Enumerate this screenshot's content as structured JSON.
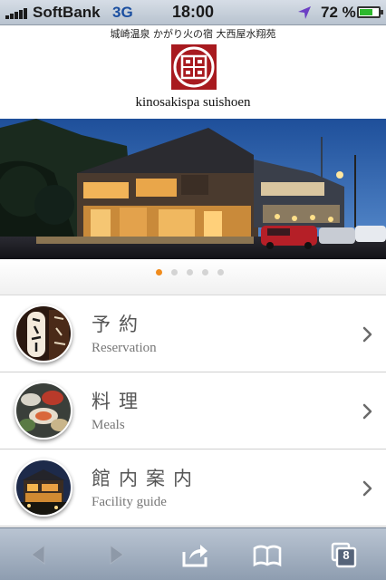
{
  "status_bar": {
    "carrier": "SoftBank",
    "network": "3G",
    "time": "18:00",
    "battery_percent": "72 %",
    "battery_level": 0.72,
    "icons": [
      "signal-bars-icon",
      "location-arrow-icon",
      "battery-icon"
    ]
  },
  "header": {
    "tagline": "城崎温泉 かがり火の宿 大西屋水翔苑",
    "brand": "kinosakispa suishoen",
    "logo_color": "#a81a1f"
  },
  "hero": {
    "image": "ryokan exterior at dusk",
    "slide_count": 5,
    "active_slide": 1,
    "active_dot_color": "#f08b1c"
  },
  "menu": {
    "items": [
      {
        "title_ja": "予約",
        "title_en": "Reservation",
        "icon": "chevron-right-icon"
      },
      {
        "title_ja": "料理",
        "title_en": "Meals",
        "icon": "chevron-right-icon"
      },
      {
        "title_ja": "館内案内",
        "title_en": "Facility guide",
        "icon": "chevron-right-icon"
      }
    ]
  },
  "toolbar": {
    "icons": [
      "back-arrow-icon",
      "forward-arrow-icon",
      "share-icon",
      "bookmarks-icon",
      "tabs-icon"
    ],
    "tab_count": "8"
  }
}
